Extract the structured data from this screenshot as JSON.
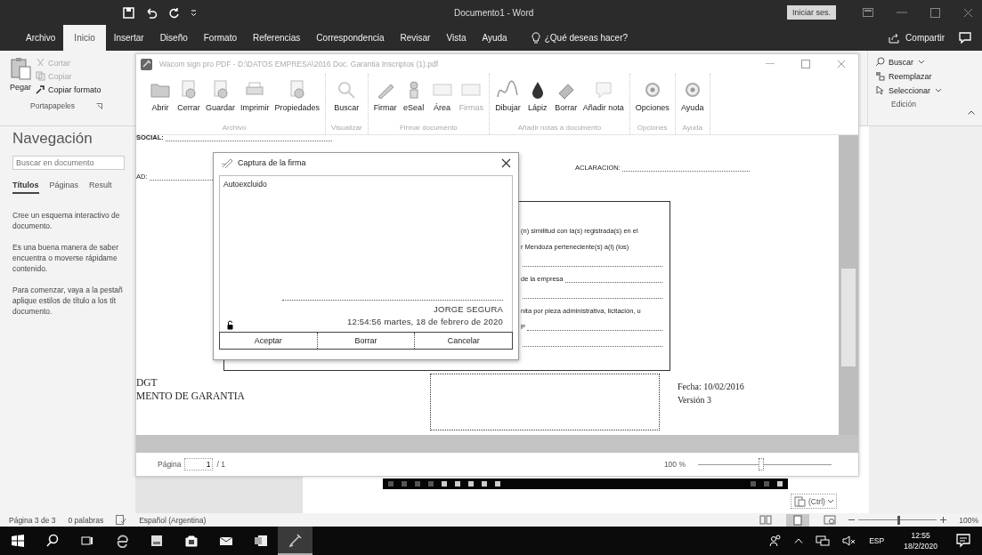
{
  "word": {
    "title": "Documento1 - Word",
    "signin_button": "Iniciar ses.",
    "tabs": [
      {
        "label": "Archivo",
        "selected": false
      },
      {
        "label": "Inicio",
        "selected": true
      },
      {
        "label": "Insertar",
        "selected": false
      },
      {
        "label": "Diseño",
        "selected": false
      },
      {
        "label": "Formato",
        "selected": false
      },
      {
        "label": "Referencias",
        "selected": false
      },
      {
        "label": "Correspondencia",
        "selected": false
      },
      {
        "label": "Revisar",
        "selected": false
      },
      {
        "label": "Vista",
        "selected": false
      },
      {
        "label": "Ayuda",
        "selected": false
      }
    ],
    "tell_me": "¿Qué deseas hacer?",
    "share": "Compartir",
    "clipboard": {
      "paste": "Pegar",
      "items": [
        {
          "label": "Cortar",
          "disabled": true
        },
        {
          "label": "Copiar",
          "disabled": true
        },
        {
          "label": "Copiar formato",
          "disabled": false
        }
      ],
      "group": "Portapapeles"
    },
    "editing": {
      "items": [
        "Buscar",
        "Reemplazar",
        "Seleccionar"
      ],
      "group": "Edición"
    }
  },
  "navigation": {
    "title": "Navegación",
    "search": {
      "placeholder": "Buscar en documento"
    },
    "tabs": [
      {
        "label": "Títulos",
        "selected": true
      },
      {
        "label": "Páginas",
        "selected": false
      },
      {
        "label": "Result",
        "selected": false
      }
    ],
    "paragraphs": [
      [
        "Cree un esquema interactivo de",
        "documento."
      ],
      [
        "Es una buena manera de saber",
        "encuentra o moverse rápidame",
        "contenido."
      ],
      [
        "Para comenzar, vaya a la pestañ",
        "aplique estilos de título a los tít",
        "documento."
      ]
    ]
  },
  "pdf_viewer": {
    "title": "Wacom sign pro PDF - D:\\DATOS EMPRESA\\2016 Doc. Garantia Inscriptos (1).pdf",
    "toolbar_groups": [
      {
        "label": "Archivo",
        "buttons": [
          "Abrir",
          "Cerrar",
          "Guardar",
          "Imprimir",
          "Propiedades"
        ]
      },
      {
        "label": "Visualizar",
        "buttons": [
          "Buscar"
        ]
      },
      {
        "label": "Firmar documento",
        "buttons": [
          "Firmar",
          "eSeal",
          "Área",
          "Firmas"
        ]
      },
      {
        "label": "Añadir notas a documento",
        "buttons": [
          "Dibujar",
          "Lápiz",
          "Borrar",
          "Añadir nota"
        ]
      },
      {
        "label": "Opciones",
        "buttons": [
          "Opciones"
        ]
      },
      {
        "label": "Ayuda",
        "buttons": [
          "Ayuda"
        ]
      }
    ],
    "document": {
      "social_label": "SOCIAL:",
      "ad_label": "AD:",
      "aclaracion_label": "ACLARACION:",
      "box_lines": [
        "(n) similitud con la(s) registrada(s) en el",
        "r Mendoza perteneciente(s) a(l) (los)",
        "de la empresa",
        "nita por pieza administrativa, licitación, u",
        "P"
      ],
      "footer_left": [
        "DGT",
        "MENTO DE GARANTIA"
      ],
      "date": "Fecha: 10/02/2016",
      "version": "Versión 3"
    },
    "page_bar": {
      "label": "Página",
      "page": "1",
      "total": "/ 1",
      "zoom": "100 %",
      "zoom_slider": {
        "level": 0.45
      }
    }
  },
  "signature_dialog": {
    "title": "Captura de la firma",
    "note": "Autoexcluido",
    "signer": "JORGE SEGURA",
    "timestamp": "12:54:56 martes, 18 de febrero de 2020",
    "buttons": [
      "Aceptar",
      "Borrar",
      "Cancelar"
    ]
  },
  "paste_options": "(Ctrl)",
  "status_bar": {
    "items": [
      "Página 3 de 3",
      "0 palabras"
    ],
    "language": "Español (Argentina)",
    "zoom": "100%",
    "zoom_slider": {
      "level": 0.5
    }
  },
  "taskbar": {
    "apps": [
      {
        "selected": false
      },
      {
        "selected": false
      },
      {
        "selected": false
      },
      {
        "selected": false
      },
      {
        "selected": false
      },
      {
        "selected": false
      },
      {
        "selected": false
      },
      {
        "selected": false
      },
      {
        "selected": true
      }
    ],
    "language": "ESP",
    "time": "12:55",
    "date": "18/2/2020"
  }
}
